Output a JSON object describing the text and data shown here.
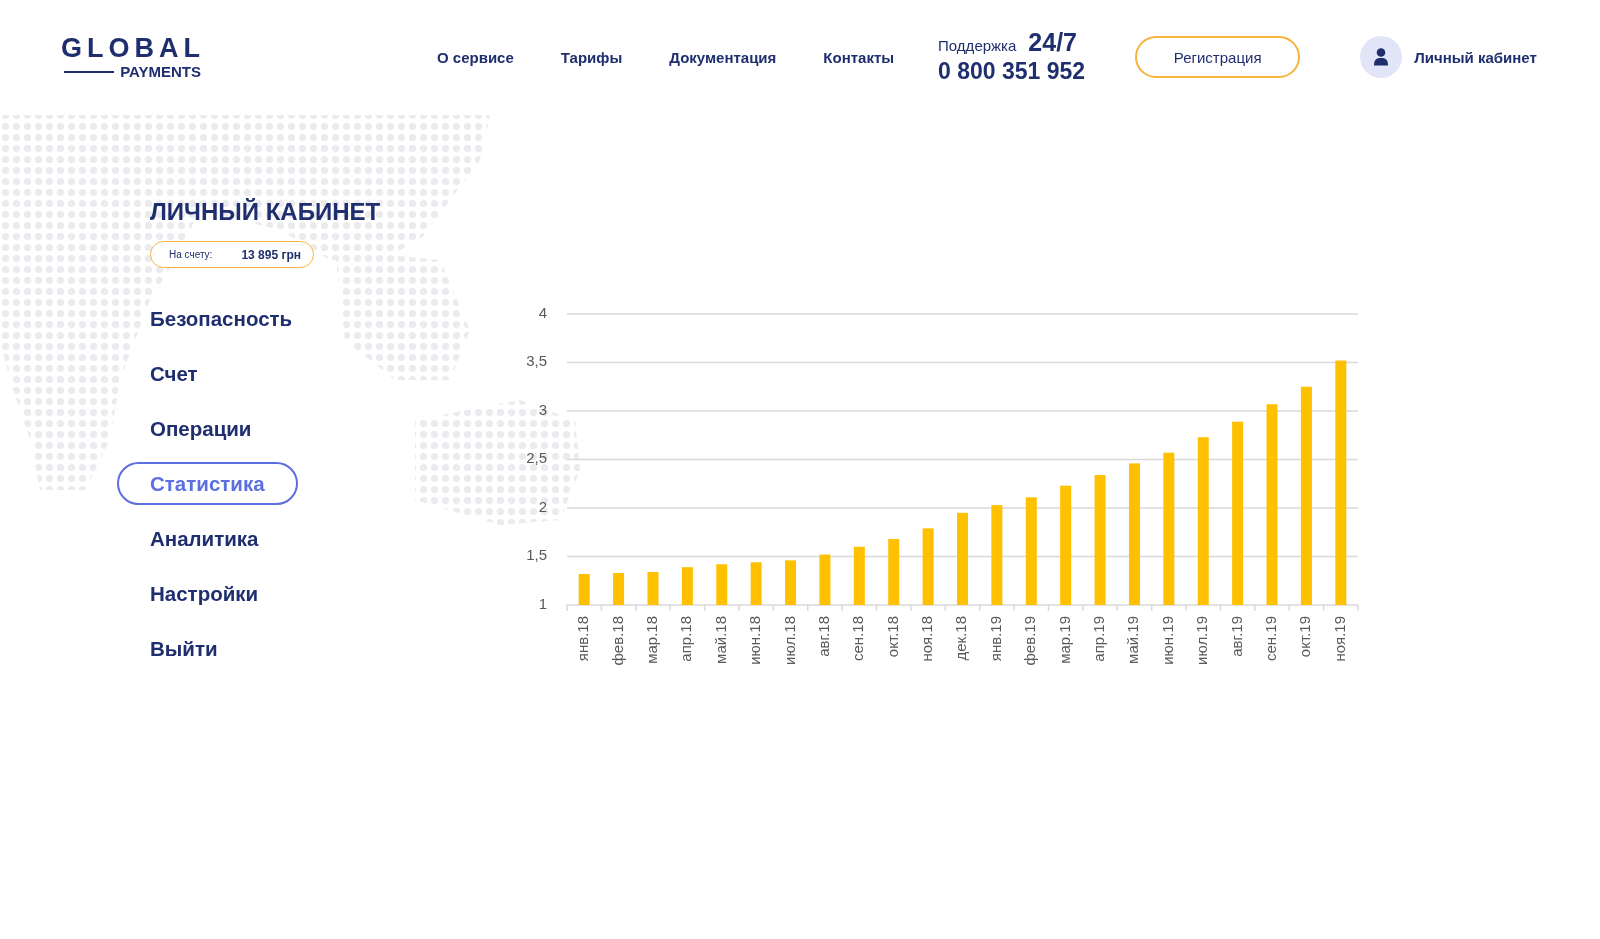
{
  "header": {
    "logo": {
      "title": "GLOBAL",
      "subtitle": "PAYMENTS"
    },
    "nav": [
      {
        "label": "О сервисе"
      },
      {
        "label": "Тарифы"
      },
      {
        "label": "Документация"
      },
      {
        "label": "Контакты"
      }
    ],
    "support": {
      "label": "Поддержка",
      "hours": "24/7",
      "phone": "0 800 351 952"
    },
    "register_button": {
      "label": "Регистрация"
    },
    "account": {
      "label": "Личный кабинет"
    }
  },
  "sidebar": {
    "title": "ЛИЧНЫЙ КАБИНЕТ",
    "balance": {
      "label": "На счету:",
      "value": "13 895 грн"
    },
    "items": [
      {
        "label": "Безопасность",
        "selected": false
      },
      {
        "label": "Счет",
        "selected": false
      },
      {
        "label": "Операции",
        "selected": false
      },
      {
        "label": "Статистика",
        "selected": true
      },
      {
        "label": "Аналитика",
        "selected": false
      },
      {
        "label": "Настройки",
        "selected": false
      },
      {
        "label": "Выйти",
        "selected": false
      }
    ]
  },
  "main": {
    "chart_data": {
      "type": "bar",
      "grid": true,
      "categories": [
        "янв.18",
        "фев.18",
        "мар.18",
        "апр.18",
        "май.18",
        "июн.18",
        "июл.18",
        "авг.18",
        "сен.18",
        "окт.18",
        "ноя.18",
        "дек.18",
        "янв.19",
        "фев.19",
        "мар.19",
        "апр.19",
        "май.19",
        "июн.19",
        "июл.19",
        "авг.19",
        "сен.19",
        "окт.19",
        "ноя.19"
      ],
      "series": [
        {
          "color": "#ffc000",
          "values": [
            1.32,
            1.33,
            1.34,
            1.39,
            1.42,
            1.44,
            1.46,
            1.52,
            1.6,
            1.68,
            1.79,
            1.95,
            2.03,
            2.11,
            2.23,
            2.34,
            2.46,
            2.57,
            2.73,
            2.89,
            3.07,
            3.25,
            3.52
          ]
        }
      ],
      "ylim": [
        1,
        4
      ],
      "yticks": [
        {
          "value": 1,
          "label": "1"
        },
        {
          "value": 1.5,
          "label": "1,5"
        },
        {
          "value": 2,
          "label": "2"
        },
        {
          "value": 2.5,
          "label": "2,5"
        },
        {
          "value": 3,
          "label": "3"
        },
        {
          "value": 3.5,
          "label": "3,5"
        },
        {
          "value": 4,
          "label": "4"
        }
      ]
    }
  }
}
